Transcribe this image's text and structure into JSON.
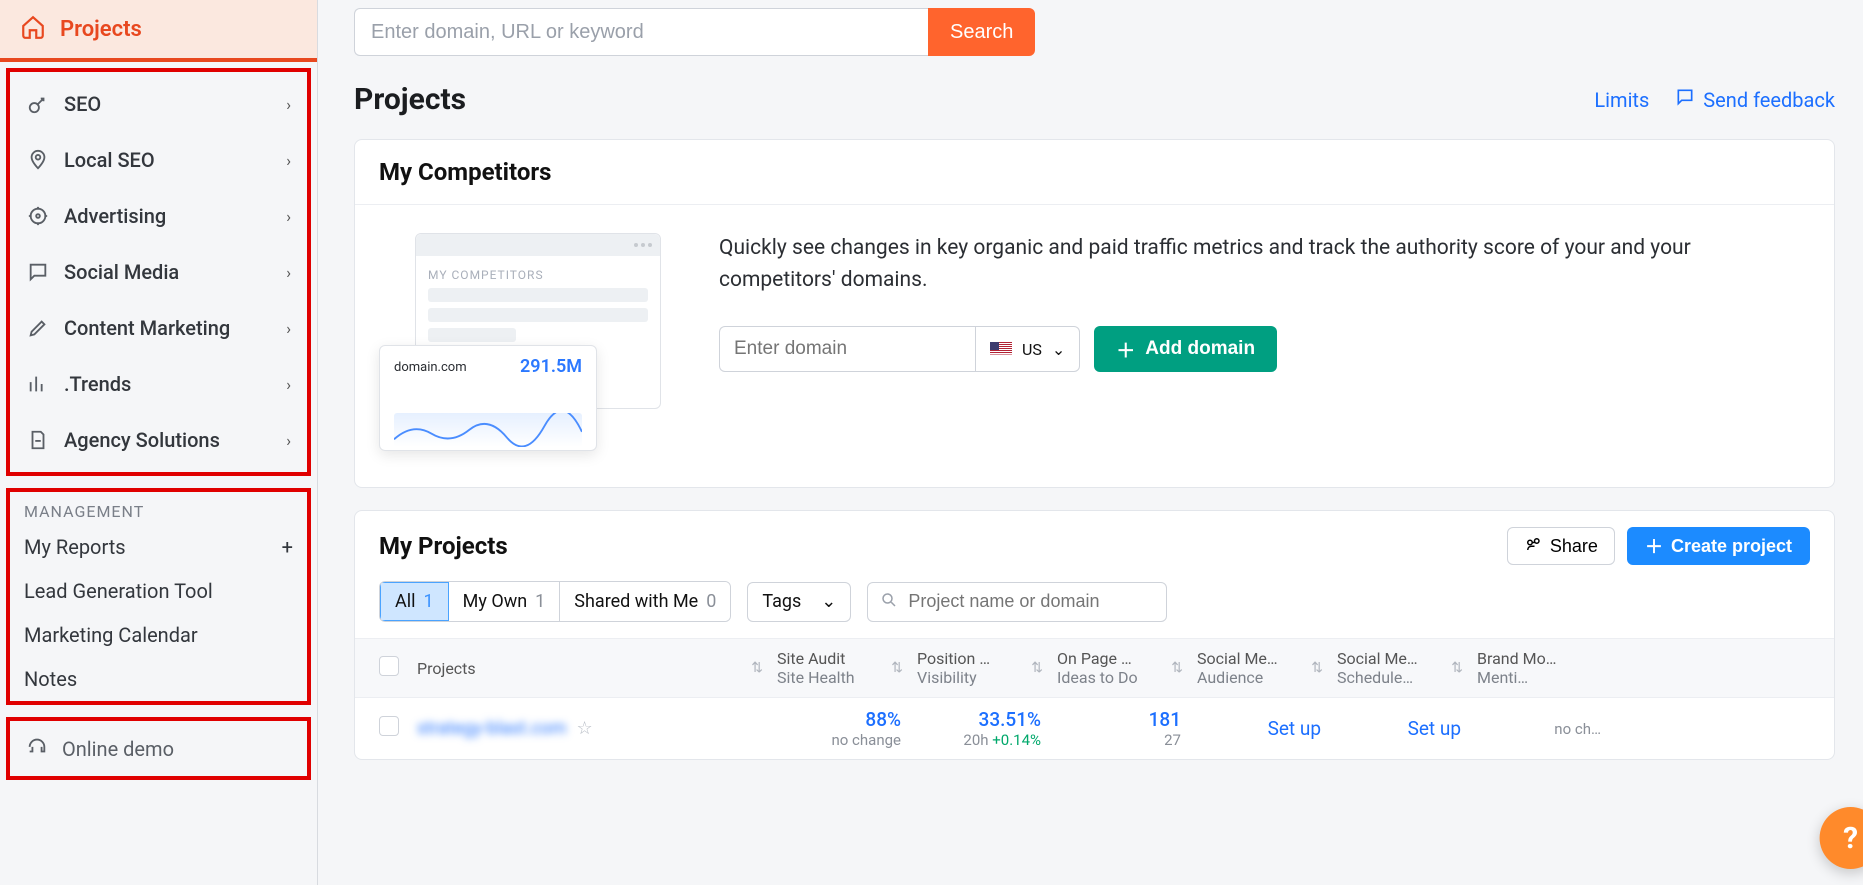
{
  "sidebar": {
    "home": "Projects",
    "nav": [
      {
        "label": "SEO"
      },
      {
        "label": "Local SEO"
      },
      {
        "label": "Advertising"
      },
      {
        "label": "Social Media"
      },
      {
        "label": "Content Marketing"
      },
      {
        "label": ".Trends"
      },
      {
        "label": "Agency Solutions"
      }
    ],
    "management_label": "MANAGEMENT",
    "management": [
      {
        "label": "My Reports",
        "add": "+"
      },
      {
        "label": "Lead Generation Tool"
      },
      {
        "label": "Marketing Calendar"
      },
      {
        "label": "Notes"
      }
    ],
    "demo": "Online demo"
  },
  "search": {
    "placeholder": "Enter domain, URL or keyword",
    "button": "Search"
  },
  "page": {
    "title": "Projects",
    "limits": "Limits",
    "feedback": "Send feedback"
  },
  "competitors": {
    "title": "My Competitors",
    "desc": "Quickly see changes in key organic and paid traffic metrics and track the authority score of your and your competitors' domains.",
    "preview_label": "MY COMPETITORS",
    "preview_domain": "domain.com",
    "preview_value": "291.5M",
    "input_placeholder": "Enter domain",
    "country": "US",
    "add_button": "Add domain"
  },
  "projects": {
    "title": "My Projects",
    "share": "Share",
    "create": "Create project",
    "filters": {
      "all": "All",
      "all_count": "1",
      "own": "My Own",
      "own_count": "1",
      "shared": "Shared with Me",
      "shared_count": "0",
      "tags": "Tags",
      "search_placeholder": "Project name or domain"
    },
    "columns": {
      "projects": "Projects",
      "audit1": "Site Audit",
      "audit2": "Site Health",
      "pos1": "Position …",
      "pos2": "Visibility",
      "page1": "On Page …",
      "page2": "Ideas to Do",
      "sm1a": "Social Me…",
      "sm1b": "Audience",
      "sm2a": "Social Me…",
      "sm2b": "Schedule…",
      "brand1": "Brand Mo…",
      "brand2": "Menti…"
    },
    "row": {
      "name": "strategy-blast.com",
      "audit_val": "88%",
      "audit_sub": "no change",
      "pos_val": "33.51%",
      "pos_sub1": "20h ",
      "pos_sub2": "+0.14%",
      "page_val": "181",
      "page_sub": "27",
      "setup": "Set up",
      "brand": "no ch…"
    }
  },
  "help": "?"
}
